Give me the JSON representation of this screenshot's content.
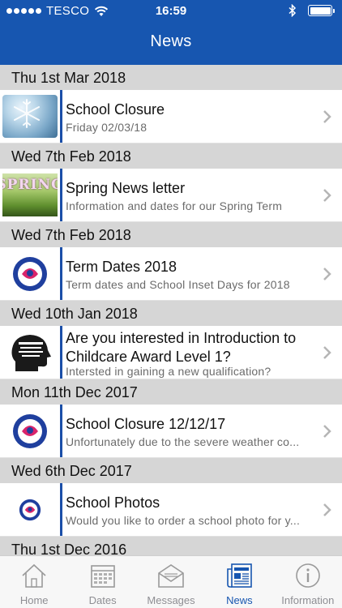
{
  "status_bar": {
    "carrier": "TESCO",
    "time": "16:59"
  },
  "nav": {
    "title": "News"
  },
  "sections": [
    {
      "header": "Thu 1st Mar 2018",
      "item": {
        "title": "School Closure",
        "subtitle": "Friday 02/03/18",
        "thumb": "snowflake"
      }
    },
    {
      "header": "Wed 7th Feb 2018",
      "item": {
        "title": "Spring News letter",
        "subtitle": "Information and dates for our Spring Term",
        "thumb": "spring",
        "thumb_text": "SPRING"
      }
    },
    {
      "header": "Wed 7th Feb 2018",
      "item": {
        "title": "Term Dates 2018",
        "subtitle": "Term dates and School Inset Days for 2018",
        "thumb": "school-logo"
      }
    },
    {
      "header": "Wed 10th Jan 2018",
      "item": {
        "title": "Are you interested in Introduction to Childcare Award Level 1?",
        "subtitle": "Intersted in gaining a new qualification?",
        "thumb": "head-silhouette"
      }
    },
    {
      "header": "Mon 11th Dec 2017",
      "item": {
        "title": "School Closure 12/12/17",
        "subtitle": "Unfortunately due to the severe weather co...",
        "thumb": "school-logo"
      }
    },
    {
      "header": "Wed 6th Dec 2017",
      "item": {
        "title": "School Photos",
        "subtitle": "Would you like to order a school photo for y...",
        "thumb": "school-logo-small"
      }
    },
    {
      "header": "Thu 1st Dec 2016"
    }
  ],
  "tabs": [
    {
      "label": "Home",
      "icon": "home-icon"
    },
    {
      "label": "Dates",
      "icon": "calendar-icon"
    },
    {
      "label": "Messages",
      "icon": "envelope-icon"
    },
    {
      "label": "News",
      "icon": "newspaper-icon",
      "active": true
    },
    {
      "label": "Information",
      "icon": "info-icon"
    }
  ],
  "colors": {
    "nav_bar": "#1756b0",
    "section_header": "#d6d6d6",
    "row_divider": "#1b4fa8",
    "tab_active": "#1756b0",
    "tab_inactive": "#8e8e93"
  }
}
